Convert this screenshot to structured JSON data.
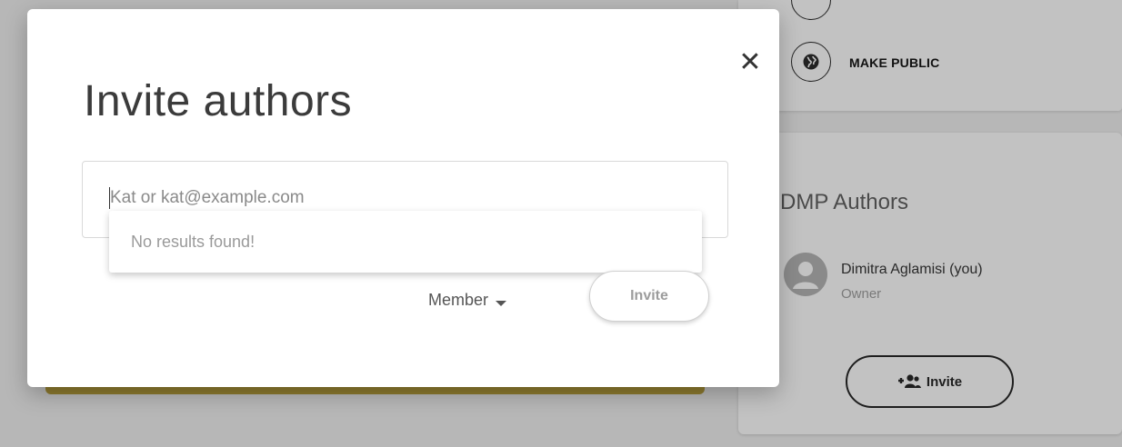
{
  "background": {
    "actions": {
      "make_public_label": "MAKE PUBLIC"
    },
    "authors_card": {
      "title": "DMP Authors",
      "authors": [
        {
          "name": "Dimitra Aglamisi (you)",
          "role": "Owner"
        }
      ],
      "invite_label": "Invite"
    }
  },
  "dialog": {
    "title": "Invite authors",
    "close_icon": "close-icon",
    "search": {
      "value": "",
      "placeholder": "Kat or kat@example.com"
    },
    "autocomplete": {
      "message": "No results found!"
    },
    "role_select": {
      "selected": "Member"
    },
    "invite_button_label": "Invite"
  }
}
